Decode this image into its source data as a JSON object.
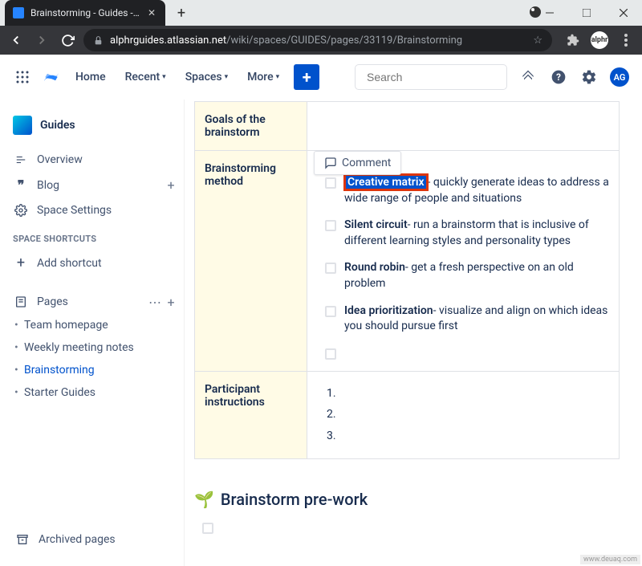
{
  "browser": {
    "tab_title": "Brainstorming - Guides - Conflu",
    "url_domain": "alphrguides.atlassian.net",
    "url_path": "/wiki/spaces/GUIDES/pages/33119/Brainstorming"
  },
  "topnav": {
    "home": "Home",
    "recent": "Recent",
    "spaces": "Spaces",
    "more": "More",
    "search_placeholder": "Search",
    "user_initials": "AG"
  },
  "sidebar": {
    "space_name": "Guides",
    "overview": "Overview",
    "blog": "Blog",
    "space_settings": "Space Settings",
    "shortcuts_label": "SPACE SHORTCUTS",
    "add_shortcut": "Add shortcut",
    "pages": "Pages",
    "tree": [
      "Team homepage",
      "Weekly meeting notes",
      "Brainstorming",
      "Starter Guides"
    ],
    "archived": "Archived pages"
  },
  "content": {
    "row1_label": "Goals of the brainstorm",
    "row2_label": "Brainstorming method",
    "row3_label": "Participant instructions",
    "comment_label": "Comment",
    "methods": [
      {
        "name": "Creative matrix",
        "desc": "- quickly generate ideas to address a wide range of people and situations",
        "highlight": true
      },
      {
        "name": "Silent circuit",
        "desc": "- run a brainstorm that is inclusive of different learning styles and personality types",
        "highlight": false
      },
      {
        "name": "Round robin",
        "desc": "- get a fresh perspective on an old problem",
        "highlight": false
      },
      {
        "name": "Idea prioritization",
        "desc": "- visualize and align on which ideas you should pursue first",
        "highlight": false
      }
    ],
    "instructions": [
      "1.",
      "2.",
      "3."
    ],
    "prework_heading": "Brainstorm pre-work"
  },
  "watermark": "www.deuaq.com"
}
